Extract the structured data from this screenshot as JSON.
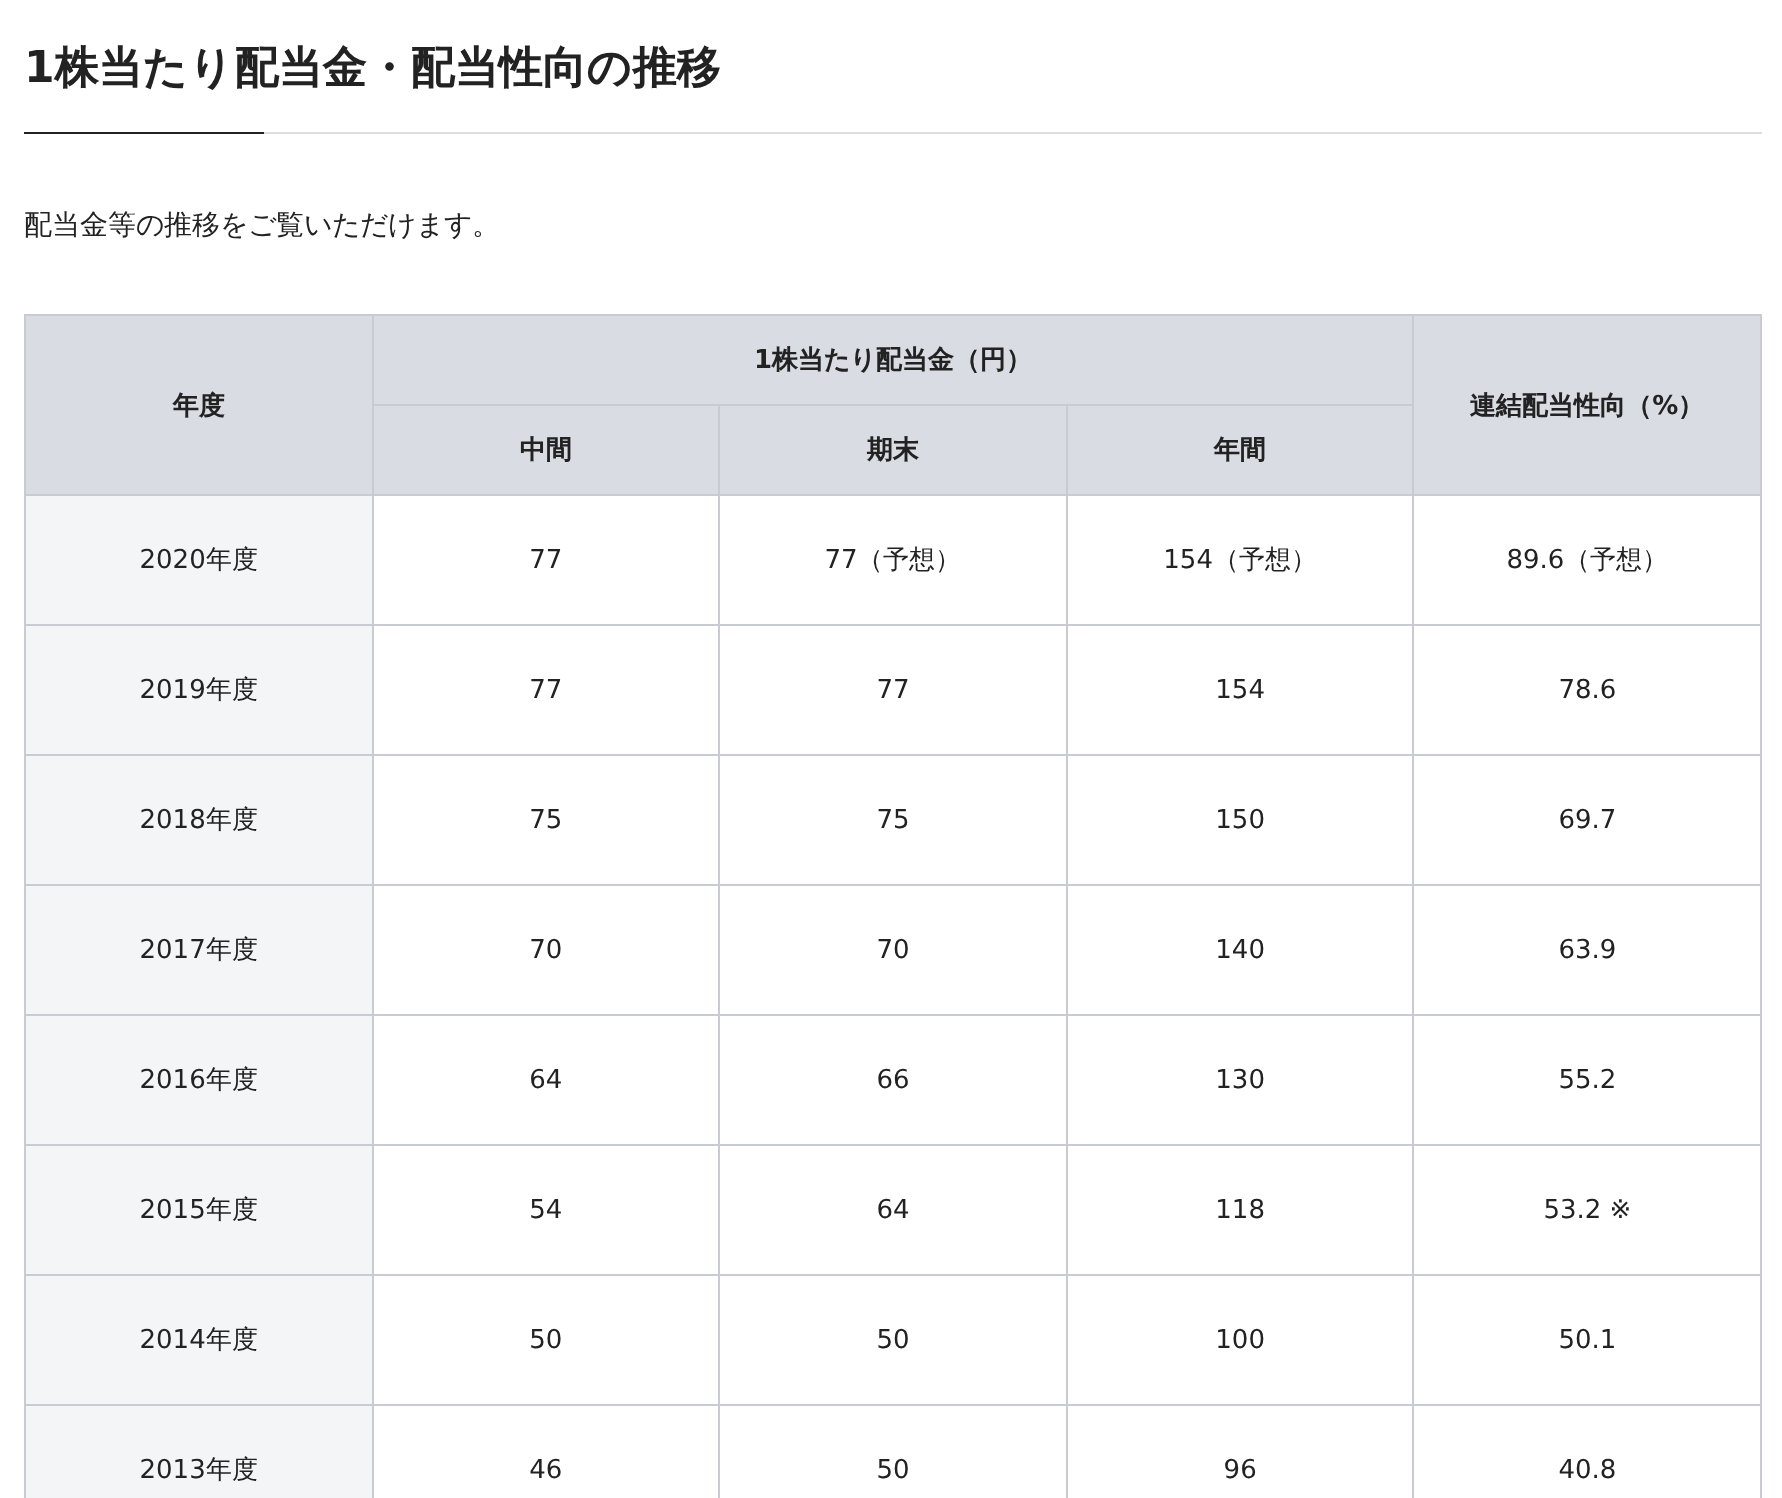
{
  "title": "1株当たり配当金・配当性向の推移",
  "intro": "配当金等の推移をご覧いただけます。",
  "table": {
    "columns": {
      "year": "年度",
      "dividend_group": "1株当たり配当金（円）",
      "interim": "中間",
      "year_end": "期末",
      "annual": "年間",
      "payout": "連結配当性向（%）"
    },
    "rows": [
      {
        "year": "2020年度",
        "interim": "77",
        "year_end": "77（予想）",
        "annual": "154（予想）",
        "payout": "89.6（予想）"
      },
      {
        "year": "2019年度",
        "interim": "77",
        "year_end": "77",
        "annual": "154",
        "payout": "78.6"
      },
      {
        "year": "2018年度",
        "interim": "75",
        "year_end": "75",
        "annual": "150",
        "payout": "69.7"
      },
      {
        "year": "2017年度",
        "interim": "70",
        "year_end": "70",
        "annual": "140",
        "payout": "63.9"
      },
      {
        "year": "2016年度",
        "interim": "64",
        "year_end": "66",
        "annual": "130",
        "payout": "55.2"
      },
      {
        "year": "2015年度",
        "interim": "54",
        "year_end": "64",
        "annual": "118",
        "payout": "53.2 ※"
      },
      {
        "year": "2014年度",
        "interim": "50",
        "year_end": "50",
        "annual": "100",
        "payout": "50.1"
      },
      {
        "year": "2013年度",
        "interim": "46",
        "year_end": "50",
        "annual": "96",
        "payout": "40.8"
      }
    ]
  }
}
